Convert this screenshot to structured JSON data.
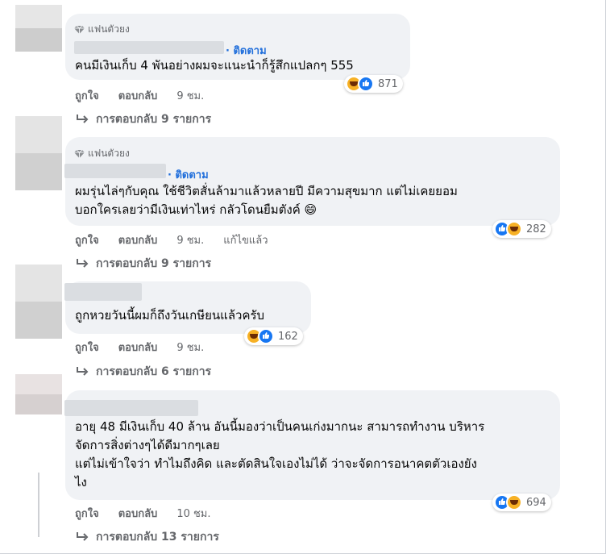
{
  "comments": [
    {
      "badge": "แฟนตัวยง",
      "follow": "· ติดตาม",
      "lines": [
        "คนมีเงินเก็บ 4 พันอย่างผมจะแนะนำก็รู้สึกแปลกๆ 555"
      ],
      "reactions": {
        "count": "871",
        "order": [
          "haha",
          "like"
        ]
      },
      "actions": {
        "like": "ถูกใจ",
        "reply": "ตอบกลับ",
        "time": "9 ชม.",
        "edited": ""
      },
      "replies": "การตอบกลับ 9 รายการ"
    },
    {
      "badge": "แฟนตัวยง",
      "follow": "· ติดตาม",
      "lines": [
        "ผมรุ่นไล่ๆกับคุณ ใช้ชีวิตสั่นล้ามาแล้วหลายปี มีความสุขมาก แต่ไม่เคยยอม",
        "บอกใครเลยว่ามีเงินเท่าไหร่ กลัวโดนยืมตังค์ 😄"
      ],
      "reactions": {
        "count": "282",
        "order": [
          "like",
          "haha"
        ]
      },
      "actions": {
        "like": "ถูกใจ",
        "reply": "ตอบกลับ",
        "time": "9 ชม.",
        "edited": "แก้ไขแล้ว"
      },
      "replies": "การตอบกลับ 9 รายการ"
    },
    {
      "badge": "",
      "follow": "",
      "lines": [
        "ถูกหวยวันนี้ผมก็ถึงวันเกษียนแล้วครับ"
      ],
      "reactions": {
        "count": "162",
        "order": [
          "haha",
          "like"
        ]
      },
      "actions": {
        "like": "ถูกใจ",
        "reply": "ตอบกลับ",
        "time": "9 ชม.",
        "edited": ""
      },
      "replies": "การตอบกลับ 6 รายการ"
    },
    {
      "badge": "",
      "follow": "",
      "lines": [
        "อายุ 48 มีเงินเก็บ 40 ล้าน อันนี้มองว่าเป็นคนเก่งมากนะ สามารถทำงาน บริหาร",
        "จัดการสิ่งต่างๆได้ดีมากๆเลย",
        "แต่ไม่เข้าใจว่า ทำไมถึงคิด และตัดสินใจเองไม่ได้ ว่าจะจัดการอนาคตตัวเองยัง",
        "ไง"
      ],
      "reactions": {
        "count": "694",
        "order": [
          "like",
          "haha"
        ]
      },
      "actions": {
        "like": "ถูกใจ",
        "reply": "ตอบกลับ",
        "time": "10 ชม.",
        "edited": ""
      },
      "replies": "การตอบกลับ 13 รายการ"
    }
  ],
  "colors": {
    "accent": "#216fdb",
    "like": "#1877f2",
    "haha": "#f7b125",
    "bubble": "#f0f2f5"
  }
}
